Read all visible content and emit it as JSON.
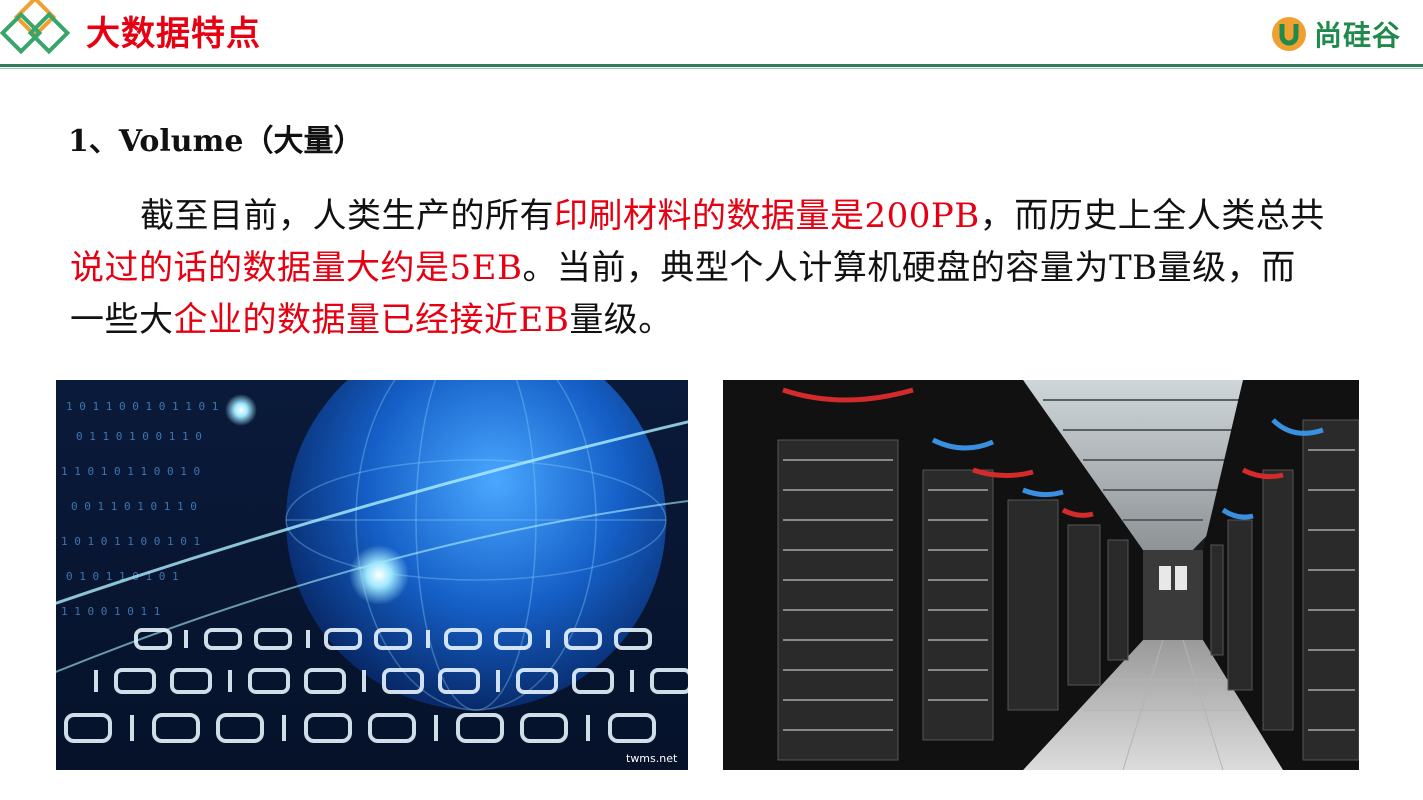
{
  "header": {
    "title": "大数据特点",
    "brand_name": "尚硅谷",
    "accent_color": "#2f7d5a",
    "title_color": "#e60012"
  },
  "section": {
    "heading": "1、Volume（大量）"
  },
  "paragraph": {
    "p1": "截至目前，人类生产的所有",
    "r1": "印刷材料的数据量是",
    "r1b": "200PB",
    "p2": "，而历史上全人类总共",
    "r2": "说过的话的数据量大约是",
    "r2b": "5EB",
    "p3": "。当前，典型个人计算机硬盘的容量为",
    "p3b": "TB",
    "p3c": "量级，而",
    "p4": "一些大",
    "r3": "企业的数据量已经接近",
    "r3b": "EB",
    "p5": "量级。"
  },
  "images": {
    "left": "digital-globe-binary-image",
    "right": "server-room-racks-image",
    "left_caption": "twms.net"
  }
}
